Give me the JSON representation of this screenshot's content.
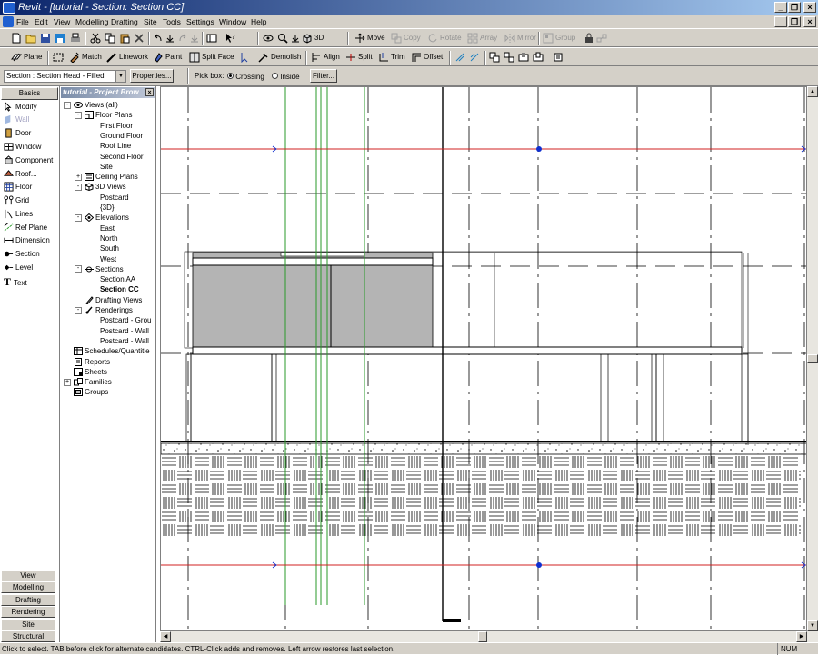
{
  "window": {
    "title": "Revit - [tutorial - Section: Section CC]",
    "controls": [
      "_",
      "❐",
      "×"
    ],
    "doc_controls": [
      "_",
      "❐",
      "×"
    ]
  },
  "menu": [
    "File",
    "Edit",
    "View",
    "Modelling",
    "Drafting",
    "Site",
    "Tools",
    "Settings",
    "Window",
    "Help"
  ],
  "toolbar1": {
    "3d_label": "3D",
    "move": "Move",
    "copy": "Copy",
    "rotate": "Rotate",
    "array": "Array",
    "mirror": "Mirror",
    "group": "Group"
  },
  "toolbar2": {
    "plane": "Plane",
    "match": "Match",
    "linework": "Linework",
    "paint": "Paint",
    "split_face": "Split Face",
    "demolish": "Demolish",
    "align": "Align",
    "split": "Split",
    "trim": "Trim",
    "offset": "Offset"
  },
  "options": {
    "type_selector": "Section : Section Head - Filled",
    "properties": "Properties...",
    "pick_box": "Pick box:",
    "crossing": "Crossing",
    "inside": "Inside",
    "filter": "Filter..."
  },
  "design_bar": {
    "header": "Basics",
    "items": [
      "Modify",
      "Wall",
      "Door",
      "Window",
      "Component",
      "Roof...",
      "Floor",
      "Grid",
      "Lines",
      "Ref Plane",
      "Dimension",
      "Section",
      "Level",
      "Text"
    ],
    "tabs": [
      "View",
      "Modelling",
      "Drafting",
      "Rendering",
      "Site",
      "Structural"
    ]
  },
  "project_browser": {
    "title": "tutorial - Project Brow",
    "tree": [
      {
        "label": "Views (all)",
        "indent": 0,
        "toggle": "-",
        "icon": "eye-icon"
      },
      {
        "label": "Floor Plans",
        "indent": 1,
        "toggle": "-",
        "icon": "floor-plan-icon"
      },
      {
        "label": "First Floor",
        "indent": 2
      },
      {
        "label": "Ground Floor",
        "indent": 2
      },
      {
        "label": "Roof Line",
        "indent": 2
      },
      {
        "label": "Second Floor",
        "indent": 2
      },
      {
        "label": "Site",
        "indent": 2
      },
      {
        "label": "Ceiling Plans",
        "indent": 1,
        "toggle": "+",
        "icon": "ceiling-plan-icon"
      },
      {
        "label": "3D Views",
        "indent": 1,
        "toggle": "-",
        "icon": "3d-view-icon"
      },
      {
        "label": "Postcard",
        "indent": 2
      },
      {
        "label": "{3D}",
        "indent": 2
      },
      {
        "label": "Elevations",
        "indent": 1,
        "toggle": "-",
        "icon": "elevation-icon"
      },
      {
        "label": "East",
        "indent": 2
      },
      {
        "label": "North",
        "indent": 2
      },
      {
        "label": "South",
        "indent": 2
      },
      {
        "label": "West",
        "indent": 2
      },
      {
        "label": "Sections",
        "indent": 1,
        "toggle": "-",
        "icon": "section-view-icon"
      },
      {
        "label": "Section AA",
        "indent": 2
      },
      {
        "label": "Section CC",
        "indent": 2,
        "bold": true
      },
      {
        "label": "Drafting Views",
        "indent": 1,
        "icon": "drafting-view-icon"
      },
      {
        "label": "Renderings",
        "indent": 1,
        "toggle": "-",
        "icon": "rendering-icon"
      },
      {
        "label": "Postcard - Grou",
        "indent": 2
      },
      {
        "label": "Postcard - Wall",
        "indent": 2
      },
      {
        "label": "Postcard - Wall",
        "indent": 2
      },
      {
        "label": "Schedules/Quantitie",
        "indent": 0,
        "icon": "schedule-icon"
      },
      {
        "label": "Reports",
        "indent": 0,
        "icon": "report-icon"
      },
      {
        "label": "Sheets",
        "indent": 0,
        "icon": "sheet-icon"
      },
      {
        "label": "Families",
        "indent": 0,
        "toggle": "+",
        "icon": "family-icon"
      },
      {
        "label": "Groups",
        "indent": 0,
        "icon": "group-icon"
      }
    ]
  },
  "status_bar": {
    "message": "Click to select. TAB before click for alternate candidates. CTRL-Click adds and removes. Left arrow restores last selection.",
    "num": "NUM"
  },
  "colors": {
    "title_gradient_start": "#0a246a",
    "title_gradient_end": "#a6caf0",
    "chrome": "#d4d0c8",
    "section_line": "#d02020",
    "grid_green": "#2a9a2a",
    "grip_blue": "#1030d0",
    "fill_gray": "#b4b4b4"
  }
}
